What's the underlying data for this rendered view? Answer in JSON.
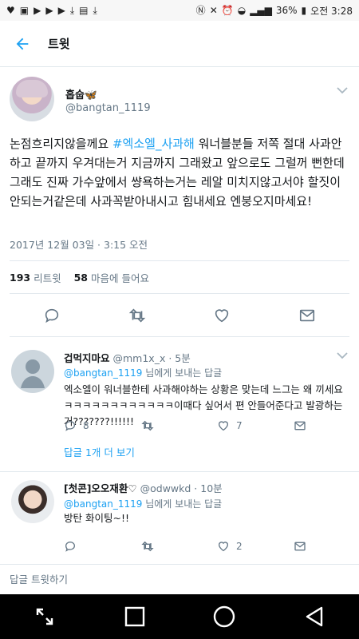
{
  "status_bar": {
    "battery": "36%",
    "time": "오전 3:28"
  },
  "header": {
    "title": "트윗"
  },
  "tweet": {
    "author_name": "홉숩🦋",
    "author_handle": "@bangtan_1119",
    "text_before": "논점흐리지않을께요 ",
    "hashtag": "#엑소엘_사과해",
    "text_after": " 워너블분들 저쪽 절대 사과안하고 끝까지 우겨대는거 지금까지 그래왔고 앞으로도 그럴꺼 뻔한데 그래도 진짜 가수앞에서 썅욕하는거는 레알 미치지않고서야 할짓이 안되는거같은데 사과꼭받아내시고 힘내세요 엔붕오지마세요!",
    "timestamp": "2017년 12월 03일 · 3:15 오전",
    "retweets_count": "193",
    "retweets_label": "리트윗",
    "likes_count": "58",
    "likes_label": "마음에 들어요"
  },
  "replies": [
    {
      "name": "겁먹지마요",
      "handle": "@mm1x_x · 5분",
      "replying_to": "@bangtan_1119",
      "replying_suffix": " 님에게 보내는 답글",
      "text": "엑소엘이 워너블한테 사과해야하는 상황은 맞는데 느그는 왜 끼세요ㅋㅋㅋㅋㅋㅋㅋㅋㅋㅋㅋㅋ이때다 싶어서 편 안들어준다고 발광하는거???????!!!!!!",
      "reply_count": "8",
      "retweet_count": "",
      "like_count": "7",
      "more_replies": "답글 1개 더 보기"
    },
    {
      "name": "[첫콘]오오재환♡",
      "handle": "@odwwkd · 10분",
      "replying_to": "@bangtan_1119",
      "replying_suffix": " 님에게 보내는 답글",
      "text": "방탄 화이팅~!!",
      "reply_count": "",
      "retweet_count": "",
      "like_count": "2"
    }
  ],
  "compose": {
    "placeholder": "답글 트윗하기"
  },
  "colors": {
    "accent": "#1da1f2",
    "secondary_text": "#657786",
    "divider": "#e1e8ed"
  },
  "icons": {
    "back": "arrow-left-icon",
    "reply": "speech-bubble-icon",
    "retweet": "retweet-icon",
    "like": "heart-icon",
    "dm": "envelope-icon"
  }
}
